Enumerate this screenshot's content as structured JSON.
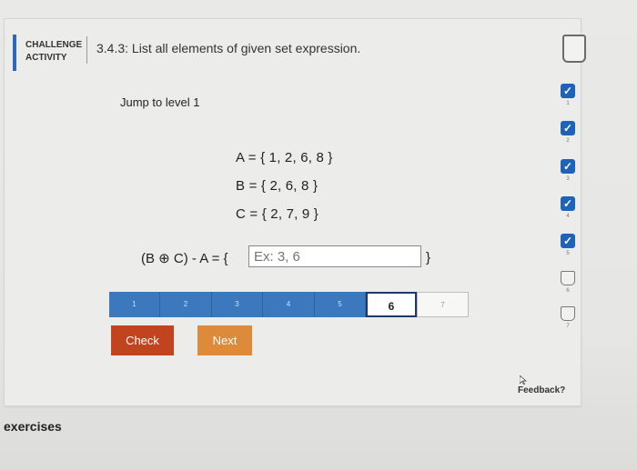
{
  "header": {
    "badge_line1": "CHALLENGE",
    "badge_line2": "ACTIVITY",
    "title": "3.4.3: List all elements of given set expression."
  },
  "main": {
    "level_title": "Jump to level 1",
    "sets": [
      "A = { 1, 2, 6, 8 }",
      "B = { 2, 6, 8 }",
      "C = { 2, 7, 9 }"
    ],
    "expression": "(B ⊕ C) - A = {",
    "input_placeholder": "Ex: 3, 6",
    "closing_brace": "}"
  },
  "level_bar": {
    "steps": [
      "1",
      "2",
      "3",
      "4",
      "5",
      "6",
      "7"
    ],
    "current": "6"
  },
  "buttons": {
    "check": "Check",
    "next": "Next"
  },
  "progress": {
    "items": [
      {
        "num": "1",
        "state": "done"
      },
      {
        "num": "2",
        "state": "done"
      },
      {
        "num": "3",
        "state": "done"
      },
      {
        "num": "4",
        "state": "done"
      },
      {
        "num": "5",
        "state": "done"
      },
      {
        "num": "6",
        "state": "empty"
      },
      {
        "num": "7",
        "state": "empty"
      }
    ]
  },
  "feedback_label": "Feedback?",
  "footer_label": "exercises",
  "colors": {
    "accent": "#1f63b9",
    "check_button": "#c2441e",
    "next_button": "#dd8a3a"
  }
}
